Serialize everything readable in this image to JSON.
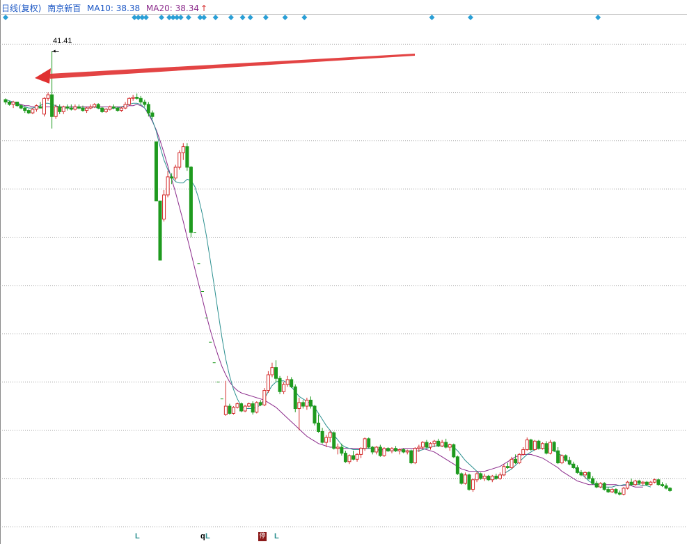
{
  "header": {
    "title": "日线(复权)",
    "stock_name": "南京新百",
    "ma10_label": "MA10: 38.38",
    "ma20_label": "MA20: 38.34",
    "ma20_arrow": "↑"
  },
  "peak_label": "41.41",
  "bottom_markers": [
    "L",
    "q",
    "L",
    "L"
  ],
  "bottom_tag": "停",
  "colors": {
    "up": "#d42b2b",
    "down": "#1e9a1e",
    "ma10": "#2a8f8f",
    "ma20": "#8b2a8b",
    "grid": "#9a9a9a",
    "diamond": "#2a9fd6",
    "arrow": "#e03030"
  },
  "chart_data": {
    "type": "candlestick",
    "title": "日线(复权)",
    "series_name": "南京新百",
    "ylim": [
      1.5,
      44.5
    ],
    "candles": [
      [
        37.4,
        37.5,
        37.0,
        37.2
      ],
      [
        37.2,
        37.3,
        36.9,
        37.0
      ],
      [
        37.0,
        37.3,
        36.7,
        37.2
      ],
      [
        37.2,
        37.2,
        36.8,
        36.9
      ],
      [
        36.9,
        37.0,
        36.6,
        36.7
      ],
      [
        36.7,
        36.8,
        36.3,
        36.5
      ],
      [
        36.5,
        36.6,
        36.2,
        36.3
      ],
      [
        36.3,
        36.7,
        36.2,
        36.6
      ],
      [
        36.6,
        37.0,
        36.4,
        36.9
      ],
      [
        36.8,
        37.2,
        36.7,
        36.7
      ],
      [
        36.2,
        37.6,
        36.0,
        37.5
      ],
      [
        37.5,
        38.0,
        37.3,
        37.8
      ],
      [
        37.8,
        41.41,
        35.0,
        36.0
      ],
      [
        36.0,
        37.0,
        35.8,
        36.8
      ],
      [
        36.8,
        37.0,
        36.2,
        36.4
      ],
      [
        36.4,
        36.9,
        36.2,
        36.8
      ],
      [
        36.8,
        37.0,
        36.5,
        36.7
      ],
      [
        36.7,
        37.0,
        36.5,
        36.6
      ],
      [
        36.6,
        37.0,
        36.5,
        36.8
      ],
      [
        36.8,
        37.0,
        36.6,
        36.7
      ],
      [
        36.7,
        36.9,
        36.4,
        36.5
      ],
      [
        36.5,
        36.8,
        36.3,
        36.7
      ],
      [
        36.7,
        37.0,
        36.6,
        36.8
      ],
      [
        36.8,
        37.1,
        36.7,
        37.0
      ],
      [
        37.0,
        37.1,
        36.6,
        36.7
      ],
      [
        36.7,
        36.8,
        36.3,
        36.4
      ],
      [
        36.4,
        36.7,
        36.3,
        36.6
      ],
      [
        36.6,
        36.9,
        36.5,
        36.8
      ],
      [
        36.8,
        37.0,
        36.6,
        36.7
      ],
      [
        36.7,
        36.8,
        36.4,
        36.5
      ],
      [
        36.5,
        36.8,
        36.4,
        36.7
      ],
      [
        36.7,
        37.2,
        36.6,
        37.0
      ],
      [
        37.0,
        37.6,
        36.9,
        37.5
      ],
      [
        37.5,
        37.8,
        37.3,
        37.6
      ],
      [
        37.6,
        37.9,
        37.4,
        37.5
      ],
      [
        37.5,
        37.7,
        37.0,
        37.2
      ],
      [
        37.2,
        37.4,
        36.8,
        37.0
      ],
      [
        37.0,
        37.2,
        36.0,
        36.3
      ],
      [
        36.3,
        36.5,
        35.8,
        36.0
      ],
      [
        33.9,
        33.9,
        29.0,
        29.0
      ],
      [
        29.0,
        29.0,
        24.1,
        24.1
      ],
      [
        27.5,
        29.9,
        27.3,
        29.5
      ],
      [
        29.5,
        31.5,
        29.3,
        31.0
      ],
      [
        31.0,
        31.3,
        30.4,
        30.9
      ],
      [
        30.9,
        32.0,
        30.7,
        31.8
      ],
      [
        31.8,
        33.2,
        31.6,
        33.0
      ],
      [
        33.0,
        33.8,
        32.4,
        33.5
      ],
      [
        33.5,
        33.8,
        31.5,
        31.8
      ],
      [
        31.8,
        31.9,
        26.0,
        26.4
      ],
      [
        26.4,
        26.4,
        26.4,
        26.4
      ],
      [
        23.8,
        23.8,
        23.8,
        23.8
      ],
      [
        21.5,
        21.5,
        21.5,
        21.5
      ],
      [
        19.3,
        19.3,
        19.3,
        19.3
      ],
      [
        17.3,
        17.3,
        17.3,
        17.3
      ],
      [
        15.6,
        15.6,
        15.6,
        15.6
      ],
      [
        14.0,
        14.0,
        14.0,
        14.0
      ],
      [
        12.6,
        12.6,
        12.6,
        12.6
      ],
      [
        11.3,
        14.1,
        11.2,
        12.0
      ],
      [
        12.0,
        12.2,
        11.3,
        11.4
      ],
      [
        11.4,
        12.0,
        11.3,
        11.9
      ],
      [
        11.9,
        12.3,
        11.8,
        12.2
      ],
      [
        12.2,
        12.3,
        11.5,
        11.6
      ],
      [
        11.6,
        12.1,
        11.5,
        12.0
      ],
      [
        12.0,
        12.3,
        11.9,
        12.2
      ],
      [
        12.2,
        12.4,
        11.3,
        11.5
      ],
      [
        11.5,
        12.4,
        11.4,
        12.3
      ],
      [
        12.3,
        12.5,
        12.0,
        12.1
      ],
      [
        12.1,
        13.5,
        12.0,
        13.3
      ],
      [
        13.3,
        14.9,
        13.1,
        14.6
      ],
      [
        14.6,
        15.6,
        14.4,
        15.2
      ],
      [
        15.2,
        15.8,
        14.0,
        14.3
      ],
      [
        14.3,
        14.5,
        13.0,
        13.2
      ],
      [
        13.2,
        14.0,
        13.0,
        13.8
      ],
      [
        13.8,
        14.5,
        13.6,
        14.2
      ],
      [
        14.2,
        14.4,
        13.5,
        13.6
      ],
      [
        13.6,
        13.8,
        11.5,
        11.8
      ],
      [
        11.8,
        12.7,
        10.0,
        12.3
      ],
      [
        12.3,
        12.5,
        11.8,
        12.0
      ],
      [
        12.0,
        12.7,
        11.7,
        12.5
      ],
      [
        12.5,
        12.8,
        11.8,
        12.0
      ],
      [
        12.0,
        12.1,
        10.4,
        10.6
      ],
      [
        10.6,
        11.3,
        9.8,
        9.9
      ],
      [
        9.9,
        10.2,
        8.9,
        9.0
      ],
      [
        9.0,
        9.6,
        8.6,
        9.4
      ],
      [
        9.4,
        10.0,
        9.0,
        9.8
      ],
      [
        9.8,
        9.9,
        8.4,
        8.5
      ],
      [
        8.5,
        8.9,
        8.0,
        8.6
      ],
      [
        8.6,
        8.9,
        7.9,
        8.1
      ],
      [
        8.1,
        8.3,
        7.3,
        7.4
      ],
      [
        7.4,
        8.0,
        7.2,
        7.9
      ],
      [
        7.9,
        8.3,
        7.5,
        7.6
      ],
      [
        7.6,
        8.1,
        7.4,
        8.0
      ],
      [
        8.0,
        8.6,
        7.7,
        8.5
      ],
      [
        8.5,
        9.4,
        8.3,
        9.3
      ],
      [
        9.3,
        9.4,
        8.5,
        8.6
      ],
      [
        8.6,
        8.7,
        8.0,
        8.2
      ],
      [
        8.2,
        8.7,
        8.0,
        8.6
      ],
      [
        8.6,
        8.8,
        7.8,
        7.9
      ],
      [
        7.9,
        8.6,
        7.8,
        8.5
      ],
      [
        8.5,
        8.6,
        8.2,
        8.3
      ],
      [
        8.3,
        8.6,
        8.1,
        8.5
      ],
      [
        8.5,
        8.7,
        8.2,
        8.3
      ],
      [
        8.3,
        8.5,
        8.0,
        8.4
      ],
      [
        8.4,
        8.5,
        8.1,
        8.2
      ],
      [
        8.2,
        8.4,
        8.0,
        8.3
      ],
      [
        8.3,
        8.4,
        7.2,
        7.3
      ],
      [
        7.3,
        8.6,
        7.2,
        8.5
      ],
      [
        8.5,
        8.8,
        8.2,
        8.6
      ],
      [
        8.6,
        9.1,
        8.4,
        9.0
      ],
      [
        9.0,
        9.2,
        8.5,
        8.6
      ],
      [
        8.6,
        9.0,
        8.4,
        8.9
      ],
      [
        8.9,
        9.2,
        8.6,
        9.1
      ],
      [
        9.1,
        9.3,
        8.6,
        8.7
      ],
      [
        8.7,
        9.2,
        8.6,
        9.0
      ],
      [
        9.0,
        9.3,
        8.5,
        8.6
      ],
      [
        8.6,
        8.9,
        8.3,
        8.8
      ],
      [
        8.8,
        8.9,
        7.7,
        7.8
      ],
      [
        7.8,
        7.9,
        6.3,
        6.4
      ],
      [
        6.4,
        6.5,
        5.5,
        5.6
      ],
      [
        5.6,
        6.5,
        5.5,
        6.3
      ],
      [
        6.3,
        6.4,
        5.0,
        5.1
      ],
      [
        5.1,
        6.0,
        4.9,
        5.9
      ],
      [
        5.9,
        6.6,
        5.7,
        6.4
      ],
      [
        6.4,
        6.5,
        5.9,
        6.0
      ],
      [
        6.0,
        6.4,
        5.8,
        6.2
      ],
      [
        6.2,
        6.3,
        5.8,
        5.9
      ],
      [
        5.9,
        6.3,
        5.7,
        6.2
      ],
      [
        6.2,
        6.4,
        5.9,
        6.0
      ],
      [
        6.0,
        6.5,
        5.9,
        6.3
      ],
      [
        6.3,
        7.2,
        6.2,
        7.0
      ],
      [
        7.0,
        7.3,
        6.8,
        6.9
      ],
      [
        6.9,
        7.8,
        6.8,
        7.6
      ],
      [
        7.6,
        8.0,
        7.2,
        7.3
      ],
      [
        7.3,
        8.1,
        7.2,
        8.0
      ],
      [
        8.0,
        8.6,
        7.9,
        8.4
      ],
      [
        8.4,
        9.4,
        8.3,
        9.2
      ],
      [
        9.2,
        9.3,
        8.3,
        8.4
      ],
      [
        8.4,
        9.2,
        8.3,
        9.1
      ],
      [
        9.1,
        9.2,
        8.4,
        8.5
      ],
      [
        8.5,
        9.0,
        8.4,
        8.9
      ],
      [
        8.9,
        9.1,
        8.0,
        8.1
      ],
      [
        8.1,
        9.2,
        8.0,
        9.0
      ],
      [
        9.0,
        9.1,
        8.2,
        8.3
      ],
      [
        8.3,
        8.6,
        7.2,
        7.3
      ],
      [
        7.3,
        8.0,
        7.2,
        7.9
      ],
      [
        7.9,
        8.0,
        7.4,
        7.5
      ],
      [
        7.5,
        7.8,
        7.1,
        7.2
      ],
      [
        7.2,
        7.4,
        6.8,
        6.9
      ],
      [
        6.9,
        7.1,
        6.4,
        6.5
      ],
      [
        6.5,
        6.7,
        6.2,
        6.3
      ],
      [
        6.3,
        6.6,
        6.0,
        6.5
      ],
      [
        6.5,
        6.6,
        5.9,
        6.0
      ],
      [
        6.0,
        6.2,
        5.5,
        5.6
      ],
      [
        5.6,
        5.8,
        5.2,
        5.3
      ],
      [
        5.3,
        5.7,
        5.2,
        5.6
      ],
      [
        5.6,
        5.7,
        5.0,
        5.1
      ],
      [
        5.1,
        5.3,
        4.8,
        4.9
      ],
      [
        4.9,
        5.2,
        4.8,
        5.1
      ],
      [
        5.1,
        5.2,
        4.7,
        4.8
      ],
      [
        4.8,
        5.0,
        4.6,
        4.7
      ],
      [
        4.7,
        5.3,
        4.6,
        5.2
      ],
      [
        5.2,
        5.8,
        5.1,
        5.7
      ],
      [
        5.7,
        6.0,
        5.4,
        5.5
      ],
      [
        5.5,
        5.9,
        5.4,
        5.8
      ],
      [
        5.8,
        5.9,
        5.5,
        5.6
      ],
      [
        5.6,
        5.8,
        5.4,
        5.7
      ],
      [
        5.7,
        5.8,
        5.4,
        5.5
      ],
      [
        5.5,
        5.8,
        5.4,
        5.7
      ],
      [
        5.7,
        6.0,
        5.6,
        5.9
      ],
      [
        5.9,
        6.0,
        5.4,
        5.5
      ],
      [
        5.5,
        5.7,
        5.3,
        5.4
      ],
      [
        5.4,
        5.6,
        5.1,
        5.2
      ],
      [
        5.2,
        5.3,
        4.9,
        5.0
      ]
    ],
    "gridlines": [
      42.0,
      38.0,
      34.0,
      30.0,
      26.0,
      22.0,
      18.0,
      14.0,
      10.0,
      6.0,
      2.0
    ],
    "ma10": [
      37.4,
      37.3,
      37.2,
      37.1,
      36.9,
      36.8,
      36.7,
      36.7,
      36.8,
      36.9,
      37.1,
      37.1,
      37.0,
      36.9,
      36.8,
      36.7,
      36.7,
      36.7,
      36.7,
      36.7,
      36.7,
      36.7,
      36.7,
      36.8,
      36.7,
      36.6,
      36.6,
      36.6,
      36.7,
      36.7,
      36.8,
      36.9,
      37.0,
      37.1,
      37.1,
      37.0,
      36.7,
      36.3,
      35.7,
      34.8,
      33.5,
      32.4,
      31.6,
      31.0,
      30.6,
      30.5,
      30.5,
      30.8,
      30.7,
      30.2,
      29.2,
      27.8,
      26.1,
      24.1,
      22.0,
      19.8,
      17.7,
      15.9,
      14.5,
      13.4,
      12.6,
      12.0,
      11.8,
      11.8,
      11.8,
      11.9,
      12.1,
      12.6,
      13.2,
      13.7,
      14.0,
      14.1,
      14.1,
      13.9,
      13.6,
      13.2,
      12.8,
      12.6,
      12.4,
      12.2,
      11.9,
      11.4,
      10.9,
      10.4,
      10.0,
      9.6,
      9.2,
      8.8,
      8.6,
      8.5,
      8.4,
      8.4,
      8.4,
      8.5,
      8.5,
      8.5,
      8.4,
      8.3,
      8.3,
      8.3,
      8.3,
      8.3,
      8.3,
      8.3,
      8.3,
      8.3,
      8.3,
      8.3,
      8.4,
      8.5,
      8.6,
      8.7,
      8.7,
      8.7,
      8.7,
      8.7,
      8.6,
      8.3,
      7.9,
      7.5,
      7.2,
      6.9,
      6.6,
      6.3,
      6.1,
      6.0,
      5.9,
      6.0,
      6.2,
      6.4,
      6.6,
      6.8,
      7.1,
      7.4,
      7.7,
      8.0,
      8.2,
      8.4,
      8.5,
      8.5,
      8.5,
      8.4,
      8.3,
      8.1,
      7.9,
      7.6,
      7.3,
      7.0,
      6.7,
      6.4,
      6.1,
      5.8,
      5.6,
      5.4,
      5.3,
      5.3,
      5.3,
      5.3,
      5.4,
      5.4,
      5.5,
      5.5,
      5.5,
      5.5,
      5.5,
      5.4,
      5.4,
      5.3
    ],
    "ma20": [
      37.2,
      37.2,
      37.1,
      37.1,
      37.0,
      36.9,
      36.9,
      36.8,
      36.8,
      36.8,
      36.8,
      36.8,
      36.8,
      36.8,
      36.8,
      36.8,
      36.8,
      36.8,
      36.8,
      36.8,
      36.8,
      36.8,
      36.8,
      36.8,
      36.8,
      36.8,
      36.8,
      36.8,
      36.8,
      36.8,
      36.8,
      36.8,
      36.9,
      36.9,
      37.0,
      36.9,
      36.7,
      36.2,
      35.6,
      34.9,
      34.0,
      33.0,
      31.9,
      30.8,
      29.7,
      28.5,
      27.3,
      26.0,
      24.7,
      23.4,
      22.1,
      20.8,
      19.5,
      18.3,
      17.2,
      16.2,
      15.3,
      14.6,
      14.0,
      13.6,
      13.3,
      13.1,
      13.0,
      12.9,
      12.8,
      12.7,
      12.6,
      12.5,
      12.3,
      12.1,
      11.9,
      11.6,
      11.3,
      11.0,
      10.7,
      10.4,
      10.1,
      9.8,
      9.5,
      9.3,
      9.1,
      8.9,
      8.8,
      8.7,
      8.6,
      8.6,
      8.5,
      8.5,
      8.5,
      8.5,
      8.5,
      8.5,
      8.5,
      8.5,
      8.5,
      8.5,
      8.4,
      8.4,
      8.4,
      8.4,
      8.4,
      8.4,
      8.4,
      8.5,
      8.5,
      8.5,
      8.5,
      8.5,
      8.5,
      8.4,
      8.3,
      8.2,
      8.0,
      7.8,
      7.6,
      7.4,
      7.2,
      7.0,
      6.8,
      6.7,
      6.6,
      6.6,
      6.6,
      6.6,
      6.6,
      6.7,
      6.8,
      6.9,
      7.0,
      7.2,
      7.4,
      7.6,
      7.8,
      7.9,
      8.0,
      8.0,
      8.0,
      7.9,
      7.8,
      7.7,
      7.5,
      7.3,
      7.1,
      6.9,
      6.6,
      6.4,
      6.2,
      6.0,
      5.8,
      5.7,
      5.6,
      5.5,
      5.5,
      5.5,
      5.5,
      5.5,
      5.5,
      5.5,
      5.5,
      5.4,
      5.4,
      5.4,
      5.4,
      5.3,
      5.3,
      5.3
    ]
  }
}
